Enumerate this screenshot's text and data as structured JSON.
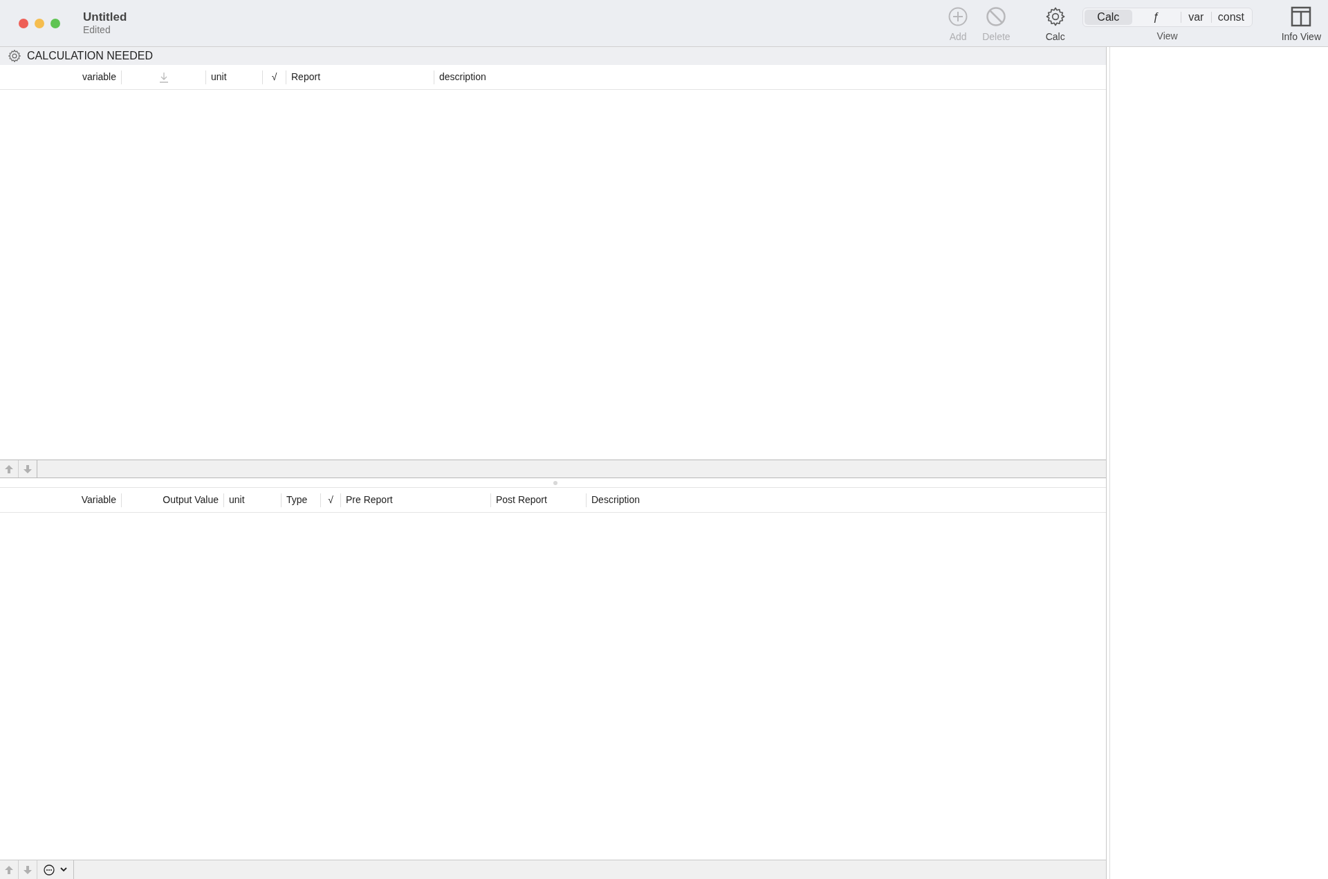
{
  "window": {
    "title": "Untitled",
    "subtitle": "Edited"
  },
  "toolbar": [
    {
      "kind": "add",
      "label": "Add",
      "disabled": true
    },
    {
      "kind": "delete",
      "label": "Delete",
      "disabled": true
    },
    {
      "kind": "calc",
      "label": "Calc",
      "disabled": false
    }
  ],
  "view": {
    "label": "View",
    "segments": [
      {
        "label": "Calc",
        "selected": true
      },
      {
        "label": "ƒ",
        "selected": false
      },
      {
        "label": "var",
        "selected": false
      },
      {
        "label": "const",
        "selected": false
      }
    ]
  },
  "info_view": {
    "label": "Info View"
  },
  "status": {
    "text": "CALCULATION NEEDED"
  },
  "input_table": {
    "columns": [
      {
        "kind": "text",
        "label": "variable"
      },
      {
        "kind": "download-icon"
      },
      {
        "kind": "text",
        "label": "unit"
      },
      {
        "kind": "text",
        "label": "√"
      },
      {
        "kind": "text",
        "label": "Report"
      },
      {
        "kind": "text",
        "label": "description"
      }
    ]
  },
  "output_table": {
    "columns": [
      {
        "kind": "text",
        "label": "Variable"
      },
      {
        "kind": "text",
        "label": "Output Value"
      },
      {
        "kind": "text",
        "label": "unit"
      },
      {
        "kind": "text",
        "label": "Type"
      },
      {
        "kind": "text",
        "label": "√"
      },
      {
        "kind": "text",
        "label": "Pre Report"
      },
      {
        "kind": "text",
        "label": "Post Report"
      },
      {
        "kind": "text",
        "label": "Description"
      }
    ]
  }
}
